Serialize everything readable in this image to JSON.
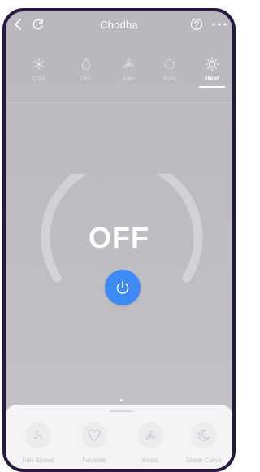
{
  "header": {
    "title": "Chodba",
    "back_icon": "chevron-left-icon",
    "refresh_icon": "refresh-icon",
    "help_icon": "help-circle-icon",
    "more_icon": "more-dots-icon"
  },
  "modes": [
    {
      "label": "Cool",
      "icon": "snowflake-icon",
      "active": false
    },
    {
      "label": "Dry",
      "icon": "droplet-icon",
      "active": false
    },
    {
      "label": "Fan",
      "icon": "fan-icon",
      "active": false
    },
    {
      "label": "Auto",
      "icon": "auto-icon",
      "active": false
    },
    {
      "label": "Heat",
      "icon": "sun-icon",
      "active": true
    }
  ],
  "dial": {
    "state_text": "OFF"
  },
  "power_button": {
    "icon": "power-icon",
    "color": "#3d8af7"
  },
  "features": [
    {
      "label": "Fan Speed",
      "icon": "fan-speed-icon"
    },
    {
      "label": "Favorite",
      "icon": "heart-icon"
    },
    {
      "label": "Boost",
      "icon": "boost-fan-icon"
    },
    {
      "label": "Sleep Curve",
      "icon": "moon-icon"
    }
  ],
  "colors": {
    "frame": "#2a1740",
    "background": "#bdbcc1",
    "accent": "#3d8af7",
    "sheet": "#f4f3f5"
  }
}
